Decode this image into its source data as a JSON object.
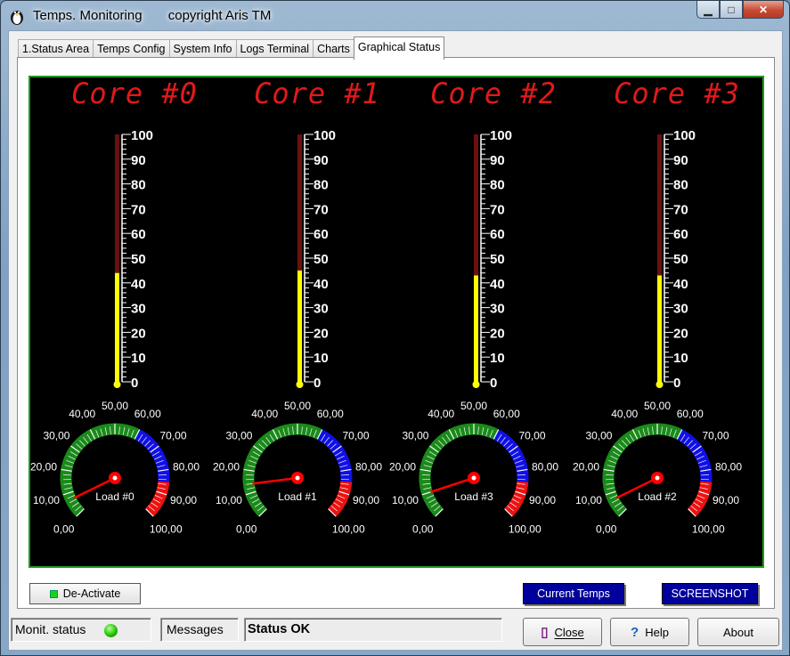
{
  "window": {
    "title": "Temps. Monitoring       copyright Aris TM",
    "minimize_icon": "minimize-icon",
    "maximize_icon": "maximize-icon",
    "close_icon": "close-icon"
  },
  "tabs": [
    {
      "label": "1.Status Area"
    },
    {
      "label": "Temps Config"
    },
    {
      "label": "System Info"
    },
    {
      "label": "Logs Terminal"
    },
    {
      "label": "Charts"
    },
    {
      "label": "Graphical Status",
      "active": true
    }
  ],
  "colors": {
    "core_title": "#e01a1a",
    "display_bg": "#000000",
    "display_border": "#1e9a1e",
    "thermo_fill": "#ffff00",
    "thermo_empty": "#6b1010",
    "gauge_green": "#1a8a1a",
    "gauge_blue": "#1010e6",
    "gauge_red": "#ee1111",
    "needle": "#ff0000",
    "button_blue": "#00009b"
  },
  "cores": [
    {
      "title": "Core #0",
      "temp": 44,
      "gauge_label": "Load #0",
      "load": 7
    },
    {
      "title": "Core #1",
      "temp": 45,
      "gauge_label": "Load #1",
      "load": 14
    },
    {
      "title": "Core #2",
      "temp": 43,
      "gauge_label": "Load #3",
      "load": 10
    },
    {
      "title": "Core #3",
      "temp": 43,
      "gauge_label": "Load #2",
      "load": 7
    }
  ],
  "thermometer_ticks": [
    "0",
    "10",
    "20",
    "30",
    "40",
    "50",
    "60",
    "70",
    "80",
    "90",
    "100"
  ],
  "gauge_ticks": [
    "0,00",
    "10,00",
    "20,00",
    "30,00",
    "40,00",
    "50,00",
    "60,00",
    "70,00",
    "80,00",
    "90,00",
    "100,00"
  ],
  "gauge_zones": {
    "green_to": 60,
    "blue_to": 85,
    "red_to": 100
  },
  "controls": {
    "deactivate_label": "De-Activate",
    "current_temps_label": "Current Temps",
    "screenshot_label": "SCREENSHOT"
  },
  "statusbar": {
    "monit_label": "Monit. status",
    "messages_label": "Messages",
    "status_text": "Status OK",
    "close_label": "Close",
    "help_label": "Help",
    "about_label": "About",
    "close_icon": "door-exit-icon",
    "help_icon": "question-mark-icon"
  }
}
